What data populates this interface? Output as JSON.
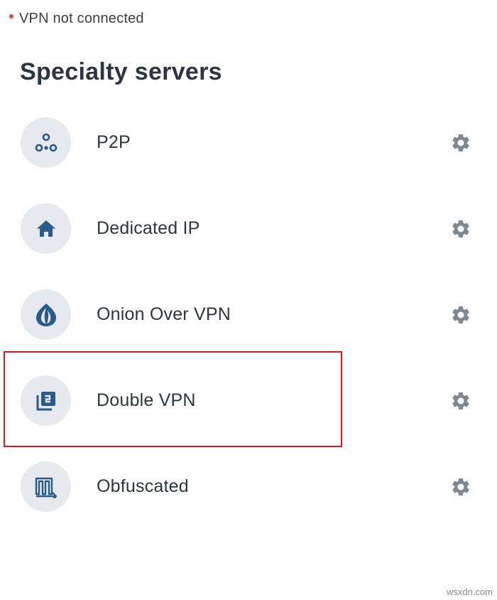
{
  "status": {
    "text": "VPN not connected",
    "dot_color": "#e0454a"
  },
  "title": "Specialty servers",
  "servers": [
    {
      "label": "P2P",
      "icon": "p2p-icon",
      "settings_icon": "gear-icon"
    },
    {
      "label": "Dedicated IP",
      "icon": "home-icon",
      "settings_icon": "gear-icon"
    },
    {
      "label": "Onion Over VPN",
      "icon": "onion-icon",
      "settings_icon": "gear-icon"
    },
    {
      "label": "Double VPN",
      "icon": "double-vpn-icon",
      "settings_icon": "gear-icon",
      "highlighted": true
    },
    {
      "label": "Obfuscated",
      "icon": "obfuscated-icon",
      "settings_icon": "gear-icon"
    }
  ],
  "colors": {
    "icon_fill": "#2a5a8a",
    "icon_bg": "#e6eaee",
    "gear": "#7d8893",
    "highlight": "#e0151c"
  },
  "watermark": "wsxdn.com"
}
